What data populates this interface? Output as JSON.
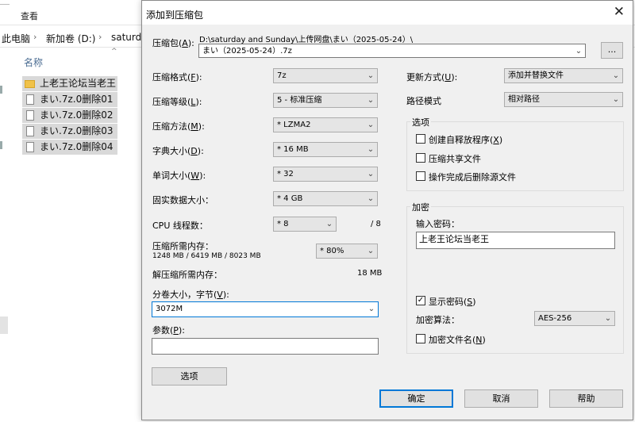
{
  "explorer": {
    "ribbon_tab_view": "查看",
    "address": [
      "此电脑",
      "新加卷 (D:)",
      "saturda"
    ],
    "column_name": "名称",
    "files": [
      {
        "name": "上老王论坛当老王",
        "type": "folder"
      },
      {
        "name": "まい.7z.0删除01",
        "type": "file"
      },
      {
        "name": "まい.7z.0删除02",
        "type": "file"
      },
      {
        "name": "まい.7z.0删除03",
        "type": "file"
      },
      {
        "name": "まい.7z.0删除04",
        "type": "file"
      }
    ]
  },
  "dialog": {
    "title": "添加到压缩包",
    "archive_label": "压缩包(",
    "archive_key": "A",
    "archive_label_end": "):",
    "archive_path": "D:\\saturday and Sunday\\上传网盘\\まい（2025-05-24）\\",
    "archive_name": "まい（2025-05-24）.7z",
    "browse_label": "...",
    "left": {
      "format": {
        "label": "压缩格式(",
        "key": "F",
        "end": "):",
        "value": "7z"
      },
      "level": {
        "label": "压缩等级(",
        "key": "L",
        "end": "):",
        "value": "5 - 标准压缩"
      },
      "method": {
        "label": "压缩方法(",
        "key": "M",
        "end": "):",
        "value": "* LZMA2"
      },
      "dict": {
        "label": "字典大小(",
        "key": "D",
        "end": "):",
        "value": "* 16 MB"
      },
      "word": {
        "label": "单词大小(",
        "key": "W",
        "end": "):",
        "value": "* 32"
      },
      "solid": {
        "label": "固实数据大小：",
        "value": "* 4 GB"
      },
      "cpu": {
        "label": "CPU 线程数：",
        "value": "* 8",
        "max": "/ 8"
      },
      "mem_compress": {
        "label": "压缩所需内存：",
        "detail": "1248 MB / 6419 MB / 8023 MB",
        "value": "* 80%"
      },
      "mem_decompress": {
        "label": "解压缩所需内存：",
        "value": "18 MB"
      },
      "split": {
        "label": "分卷大小，字节(",
        "key": "V",
        "end": "):",
        "value": "3072M"
      },
      "params": {
        "label": "参数(",
        "key": "P",
        "end": "):",
        "value": ""
      },
      "options_button": "选项"
    },
    "right": {
      "update": {
        "label": "更新方式(",
        "key": "U",
        "end": "):",
        "value": "添加并替换文件"
      },
      "path_mode": {
        "label": "路径模式",
        "value": "相对路径"
      },
      "options_group": "选项",
      "opt_sfx": {
        "label": "创建自释放程序(",
        "key": "X",
        "end": ")"
      },
      "opt_shared": {
        "label": "压缩共享文件"
      },
      "opt_delete": {
        "label": "操作完成后删除源文件"
      },
      "encrypt_group": "加密",
      "password_label": "输入密码：",
      "password_value": "上老王论坛当老王",
      "show_password": {
        "label": "显示密码(",
        "key": "S",
        "end": ")"
      },
      "enc_method_label": "加密算法：",
      "enc_method_value": "AES-256",
      "enc_names": {
        "label": "加密文件名(",
        "key": "N",
        "end": ")"
      }
    },
    "buttons": {
      "ok": "确定",
      "cancel": "取消",
      "help": "帮助"
    }
  }
}
